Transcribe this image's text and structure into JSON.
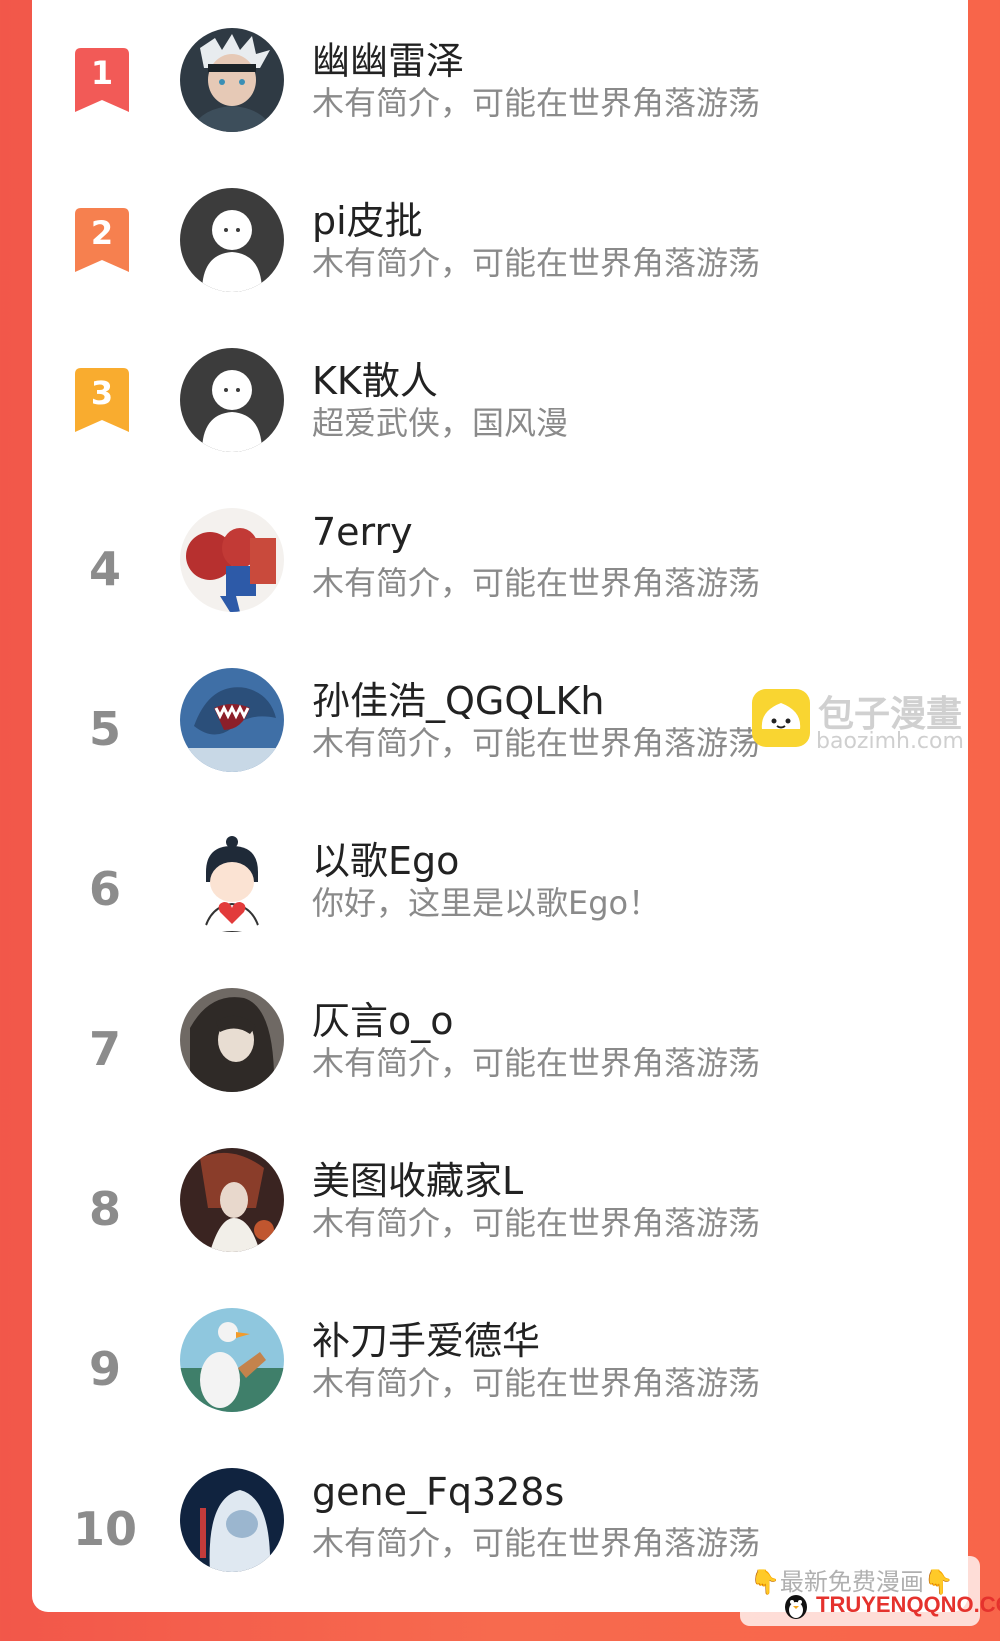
{
  "ranking": [
    {
      "rank": "1",
      "badge_color": "#f25a57",
      "name": "幽幽雷泽",
      "desc": "木有简介，可能在世界角落游荡",
      "avatar": "anime-boy-avatar"
    },
    {
      "rank": "2",
      "badge_color": "#f6804f",
      "name": "pi皮批",
      "desc": "木有简介，可能在世界角落游荡",
      "avatar": "default-avatar"
    },
    {
      "rank": "3",
      "badge_color": "#f9ac2f",
      "name": "KK散人",
      "desc": "超爱武侠，国风漫",
      "avatar": "default-avatar"
    },
    {
      "rank": "4",
      "name": "7erry",
      "desc": "木有简介，可能在世界角落游荡",
      "avatar": "spider-hero-avatar"
    },
    {
      "rank": "5",
      "name": "孙佳浩_QGQLKh",
      "desc": "木有简介，可能在世界角落游荡",
      "avatar": "shark-avatar"
    },
    {
      "rank": "6",
      "name": "以歌Ego",
      "desc": "你好，这里是以歌Ego！",
      "avatar": "boy-heart-avatar"
    },
    {
      "rank": "7",
      "name": "仄言o_o",
      "desc": "木有简介，可能在世界角落游荡",
      "avatar": "anime-portrait-avatar"
    },
    {
      "rank": "8",
      "name": "美图收藏家L",
      "desc": "木有简介，可能在世界角落游荡",
      "avatar": "dark-art-avatar"
    },
    {
      "rank": "9",
      "name": "补刀手爱德华",
      "desc": "木有简介，可能在世界角落游荡",
      "avatar": "goose-avatar"
    },
    {
      "rank": "10",
      "name": "gene_Fq328s",
      "desc": "木有简介，可能在世界角落游荡",
      "avatar": "hazmat-avatar"
    }
  ],
  "watermark": {
    "title": "包子漫畫",
    "url": "baozimh.com"
  },
  "footer_watermark": {
    "top": "👇最新免费漫画👇",
    "bottom": "TRUYENQQNO.COM"
  },
  "colors": {
    "background": "#f5604b",
    "name": "#222222",
    "desc": "#8a8a8a",
    "rank": "#8c8c8c"
  }
}
